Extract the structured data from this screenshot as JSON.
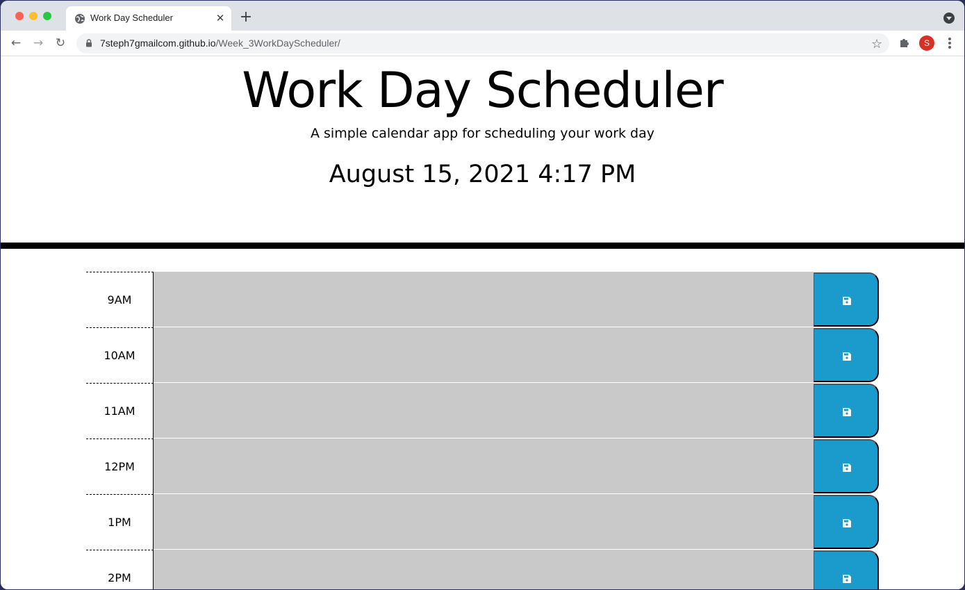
{
  "browser": {
    "tab_title": "Work Day Scheduler",
    "url_host": "7steph7gmailcom.github.io",
    "url_path": "/Week_3WorkDayScheduler/",
    "profile_initial": "S"
  },
  "header": {
    "title": "Work Day Scheduler",
    "lead": "A simple calendar app for scheduling your work day",
    "current_day": "August 15, 2021 4:17 PM"
  },
  "time_blocks": [
    {
      "hour": "9AM",
      "text": ""
    },
    {
      "hour": "10AM",
      "text": ""
    },
    {
      "hour": "11AM",
      "text": ""
    },
    {
      "hour": "12PM",
      "text": ""
    },
    {
      "hour": "1PM",
      "text": ""
    },
    {
      "hour": "2PM",
      "text": ""
    }
  ],
  "colors": {
    "past_block": "#c9c9c9",
    "save_button": "#1a9bcb"
  },
  "icons": {
    "save": "floppy-disk-icon"
  }
}
